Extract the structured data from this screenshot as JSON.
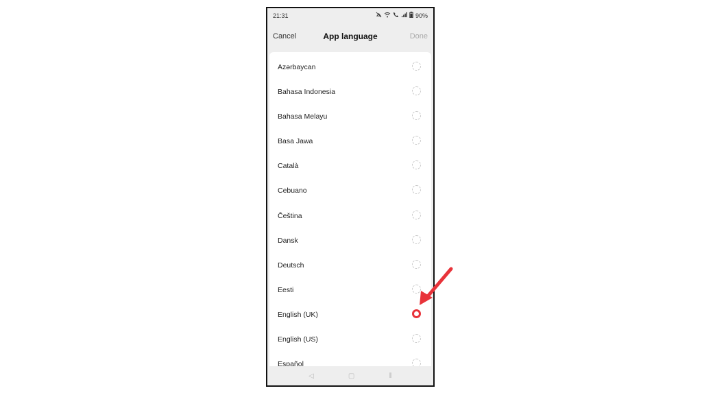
{
  "status_bar": {
    "time": "21:31",
    "battery": "90%",
    "icons": [
      "mute-icon",
      "wifi-icon",
      "call-icon",
      "signal-icon",
      "battery-icon"
    ]
  },
  "header": {
    "cancel_label": "Cancel",
    "title": "App language",
    "done_label": "Done"
  },
  "languages": [
    {
      "label": "Azərbaycan",
      "selected": false
    },
    {
      "label": "Bahasa Indonesia",
      "selected": false
    },
    {
      "label": "Bahasa Melayu",
      "selected": false
    },
    {
      "label": "Basa Jawa",
      "selected": false
    },
    {
      "label": "Català",
      "selected": false
    },
    {
      "label": "Cebuano",
      "selected": false
    },
    {
      "label": "Čeština",
      "selected": false
    },
    {
      "label": "Dansk",
      "selected": false
    },
    {
      "label": "Deutsch",
      "selected": false
    },
    {
      "label": "Eesti",
      "selected": false
    },
    {
      "label": "English (UK)",
      "selected": true
    },
    {
      "label": "English (US)",
      "selected": false
    },
    {
      "label": "Español",
      "selected": false
    }
  ],
  "nav_bar": {
    "back_glyph": "◁",
    "home_glyph": "▢",
    "recents_glyph": "⦀"
  },
  "colors": {
    "accent": "#e8333a",
    "annotation_arrow": "#e8333a"
  }
}
